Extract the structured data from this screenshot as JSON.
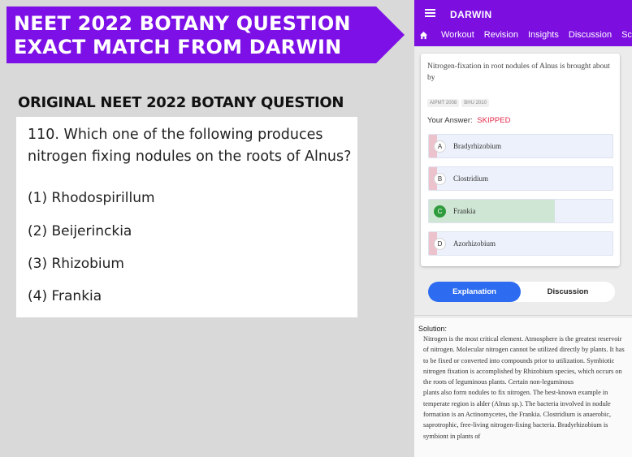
{
  "banner": {
    "line1": "NEET 2022 BOTANY QUESTION",
    "line2": "EXACT MATCH FROM DARWIN",
    "color": "#7d10e6"
  },
  "original": {
    "heading": "ORIGINAL NEET 2022 BOTANY QUESTION",
    "question": "110. Which one of the following produces nitrogen fixing nodules on the roots of Alnus?",
    "options": [
      "(1) Rhodospirillum",
      "(2) Beijerinckia",
      "(3) Rhizobium",
      "(4) Frankia"
    ]
  },
  "app": {
    "title": "DARWIN",
    "accent": "#7c0fe0",
    "nav": [
      "Workout",
      "Revision",
      "Insights",
      "Discussion",
      "Sc"
    ],
    "question": "Nitrogen-fixation in root nodules of Alnus is brought about by",
    "tags": [
      "AIPMT 2008",
      "BHU 2010"
    ],
    "your_answer_label": "Your Answer:",
    "your_answer_value": "SKIPPED",
    "options": [
      {
        "letter": "A",
        "text": "Bradyrhizobium"
      },
      {
        "letter": "B",
        "text": "Clostridium"
      },
      {
        "letter": "C",
        "text": "Frankia"
      },
      {
        "letter": "D",
        "text": "Azorhizobium"
      }
    ],
    "tabs": {
      "explanation": "Explanation",
      "discussion": "Discussion"
    },
    "solution_label": "Solution:",
    "solution_text": "Nitrogen is the most critical element. Atmosphere is the greatest reservoir of nitrogen. Molecular nitrogen cannot be utilized directly by plants. It has to be fixed or converted into compounds prior to utilization. Symbiotic nitrogen fixation is accomplished by Rhizobium species, which occurs on the roots of leguminous plants. Certain non-leguminous\nplants also form nodules to fix nitrogen. The best-known example in temperate region is alder (Alnus sp.). The bacteria involved in nodule formation is an Actinomycetes, the Frankia. Clostridium is anaerobic, saprotrophic, free-living nitrogen-fixing bacteria. Bradyrhizobium is symbiont in plants of"
  }
}
